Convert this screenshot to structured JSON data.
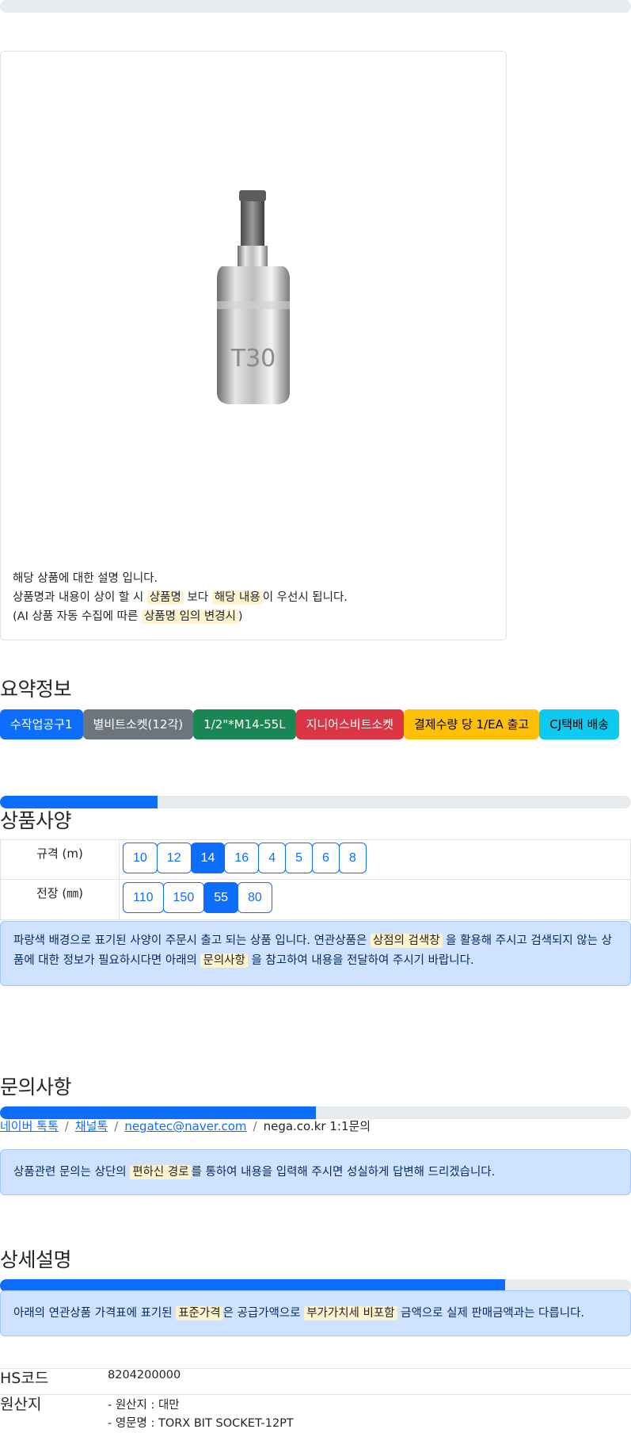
{
  "product": {
    "description_line1": "해당 상품에 대한 설명 입니다.",
    "description_line2_a": "상품명과 내용이 상이 할 시 ",
    "description_line2_hl1": "상품명",
    "description_line2_b": " 보다 ",
    "description_line2_hl2": "해당 내용",
    "description_line2_c": "이 우선시 됩니다.",
    "description_line3_a": "(AI 상품 자동 수집에 따른 ",
    "description_line3_hl": "상품명 임의 변경시",
    "description_line3_b": ")",
    "image_label": "T30"
  },
  "summary": {
    "title": "요약정보",
    "badges": [
      {
        "label": "수작업공구1",
        "bg": "#0d6efd",
        "fg": "#ffffff"
      },
      {
        "label": "별비트소켓(12각)",
        "bg": "#6c757d",
        "fg": "#ffffff"
      },
      {
        "label": "1/2\"*M14-55L",
        "bg": "#198754",
        "fg": "#ffffff"
      },
      {
        "label": "지니어스비트소켓",
        "bg": "#dc3545",
        "fg": "#ffffff"
      },
      {
        "label": "결제수량 당 1/EA 출고",
        "bg": "#ffc107",
        "fg": "#000000"
      },
      {
        "label": "CJ택배 배송",
        "bg": "#0dcaf0",
        "fg": "#000000"
      }
    ],
    "progress": 0.25
  },
  "specs": {
    "title": "상품사양",
    "rows": [
      {
        "label": "규격 (m)",
        "options": [
          "10",
          "12",
          "14",
          "16",
          "4",
          "5",
          "6",
          "8"
        ],
        "selected": "14"
      },
      {
        "label": "전장 (㎜)",
        "options": [
          "110",
          "150",
          "55",
          "80"
        ],
        "selected": "55"
      }
    ],
    "notice_a": "파랑색 배경으로 표기된 사양이 주문시 출고 되는 상품 입니다. 연관상품은 ",
    "notice_hl1": "상점의 검색창",
    "notice_b": " 을 활용해 주시고 검색되지 않는 상품에 대한 정보가 필요하시다면 아래의 ",
    "notice_hl2": "문의사항",
    "notice_c": " 을 참고하여 내용을 전달하여 주시기 바랍니다."
  },
  "inquiry": {
    "title": "문의사항",
    "progress": 0.5,
    "links": [
      "네이버 톡톡",
      "채널톡",
      "negatec@naver.com"
    ],
    "plain": "nega.co.kr 1:1문의",
    "separator": "/",
    "notice_a": "상품관련 문의는 상단의 ",
    "notice_hl": "편하신 경로",
    "notice_b": "를 통하여 내용을 입력해 주시면 성실하게 답변해 드리겠습니다."
  },
  "detail": {
    "title": "상세설명",
    "progress": 0.8,
    "notice_a": "아래의 연관상품 가격표에 표기된 ",
    "notice_hl1": "표준가격",
    "notice_b": "은 공급가액으로 ",
    "notice_hl2": "부가가치세 비포함",
    "notice_c": " 금액으로 실제 판매금액과는 다릅니다.",
    "hs_label": "HS코드",
    "hs_value": "8204200000",
    "origin_label": "원산지",
    "origin_line1": "- 원산지 : 대만",
    "origin_line2": "- 영문명 : TORX BIT SOCKET-12PT"
  },
  "colors": {
    "primary": "#0d6efd",
    "highlight": "#fff3cd",
    "alert_bg": "#cfe2ff"
  }
}
